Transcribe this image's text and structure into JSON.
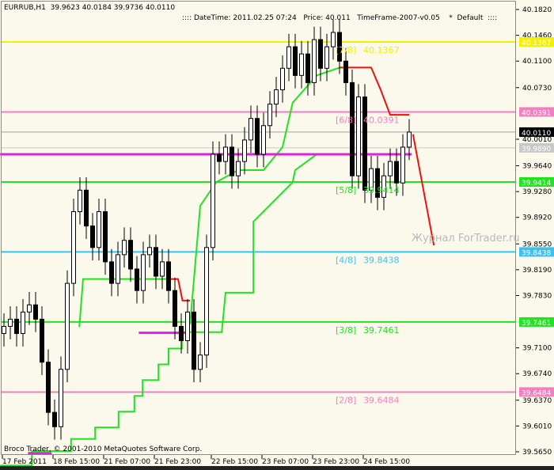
{
  "header": {
    "symbol_info": "EURRUB,H1  39.9623 40.0184 39.9736 40.0110",
    "indicator_info": ":::: DateTime: 2011.02.25 07:24   Price: 40.011   TimeFrame-2007-v0.05    *  Default  ::::"
  },
  "footer": {
    "copyright": "Broco Trader, © 2001-2010 MetaQuotes Software Corp."
  },
  "watermark": "Журнал ForTrader.ru",
  "colors": {
    "background": "#fbf9ec",
    "yellow": "#f5f000",
    "pink": "#f27fc0",
    "green": "#22e222",
    "cyan": "#3cc2f0",
    "red": "#f01010",
    "magenta": "#e020e0"
  },
  "chart_data": {
    "type": "candlestick",
    "title": "EURRUB,H1",
    "ylim": [
      39.565,
      40.182
    ],
    "y_ticks": [
      "40.1820",
      "40.1460",
      "40.1100",
      "40.0730",
      "40.0010",
      "39.9640",
      "39.9280",
      "39.8920",
      "39.8550",
      "39.8190",
      "39.7830",
      "39.7100",
      "39.6740",
      "39.6370",
      "39.6010",
      "39.5650"
    ],
    "x_ticks": [
      {
        "bar": 0,
        "label": "17 Feb 2011"
      },
      {
        "bar": 8,
        "label": "18 Feb 15:00"
      },
      {
        "bar": 16,
        "label": "21 Feb 07:00"
      },
      {
        "bar": 24,
        "label": "21 Feb 23:00"
      },
      {
        "bar": 33,
        "label": "22 Feb 15:00"
      },
      {
        "bar": 41,
        "label": "23 Feb 07:00"
      },
      {
        "bar": 49,
        "label": "23 Feb 23:00"
      },
      {
        "bar": 57,
        "label": "24 Feb 15:00"
      }
    ],
    "closes": [
      39.74,
      39.75,
      39.73,
      39.76,
      39.77,
      39.75,
      39.69,
      39.62,
      39.6,
      39.68,
      39.8,
      39.9,
      39.93,
      39.88,
      39.85,
      39.9,
      39.83,
      39.8,
      39.84,
      39.86,
      39.82,
      39.79,
      39.84,
      39.85,
      39.81,
      39.83,
      39.79,
      39.74,
      39.72,
      39.76,
      39.68,
      39.7,
      39.85,
      39.98,
      39.97,
      39.99,
      39.95,
      39.97,
      40.0,
      40.03,
      39.98,
      40.02,
      40.05,
      40.07,
      40.1,
      40.13,
      40.09,
      40.12,
      40.08,
      40.14,
      40.1,
      40.13,
      40.15,
      40.11,
      40.08,
      39.95,
      40.06,
      39.93,
      39.96,
      39.92,
      39.95,
      39.97,
      39.94,
      39.99,
      40.011
    ],
    "levels": [
      {
        "name": "[7/8]",
        "value": "40.1367",
        "price": 40.1367,
        "color": "#f5f000"
      },
      {
        "name": "[6/8]",
        "value": "40.0391",
        "price": 40.0391,
        "color": "#f27fc0"
      },
      {
        "name": "[5/8]",
        "value": "39.9414",
        "price": 39.9414,
        "color": "#22e222"
      },
      {
        "name": "[4/8]",
        "value": "39.8438",
        "price": 39.8438,
        "color": "#3cc2f0"
      },
      {
        "name": "[3/8]",
        "value": "39.7461",
        "price": 39.7461,
        "color": "#22e222"
      },
      {
        "name": "[2/8]",
        "value": "39.6484",
        "price": 39.6484,
        "color": "#f27fc0"
      }
    ],
    "price_tags": [
      {
        "value": "40.1367",
        "price": 40.1367,
        "bg": "#f5f000",
        "fg": "#ffffff"
      },
      {
        "value": "40.0391",
        "price": 40.0391,
        "bg": "#f27fc0",
        "fg": "#ffffff"
      },
      {
        "value": "40.0110",
        "price": 40.011,
        "bg": "#000000",
        "fg": "#ffffff"
      },
      {
        "value": "39.9890",
        "price": 39.989,
        "bg": "#c8c8c8",
        "fg": "#ffffff"
      },
      {
        "value": "39.9414",
        "price": 39.9414,
        "bg": "#22e222",
        "fg": "#ffffff"
      },
      {
        "value": "39.8438",
        "price": 39.8438,
        "bg": "#3cc2f0",
        "fg": "#ffffff"
      },
      {
        "value": "39.7461",
        "price": 39.7461,
        "bg": "#22e222",
        "fg": "#ffffff"
      },
      {
        "value": "39.6484",
        "price": 39.6484,
        "bg": "#f27fc0",
        "fg": "#ffffff"
      }
    ],
    "current_price": 40.011,
    "grey_level": 39.989,
    "series": [
      {
        "name": "support-lower",
        "color": "#22e222",
        "points": [
          [
            -0.6,
            39.546
          ],
          [
            4.4,
            39.546
          ],
          [
            4.4,
            39.566
          ],
          [
            10.6,
            39.566
          ],
          [
            10.6,
            39.583
          ],
          [
            14.4,
            39.583
          ],
          [
            14.4,
            39.599
          ],
          [
            18.1,
            39.599
          ],
          [
            18.1,
            39.621
          ],
          [
            20.6,
            39.621
          ],
          [
            20.6,
            39.643
          ],
          [
            21.9,
            39.643
          ],
          [
            21.9,
            39.665
          ],
          [
            24.4,
            39.665
          ],
          [
            24.4,
            39.687
          ],
          [
            26,
            39.687
          ],
          [
            26,
            39.709
          ],
          [
            28.1,
            39.709
          ],
          [
            28.1,
            39.732
          ],
          [
            34.4,
            39.732
          ],
          [
            35,
            39.787
          ],
          [
            39.4,
            39.787
          ],
          [
            39.4,
            39.886
          ],
          [
            45.6,
            39.941
          ],
          [
            46,
            39.958
          ],
          [
            49.4,
            39.98
          ],
          [
            64.4,
            39.98
          ]
        ]
      },
      {
        "name": "support-upper-1",
        "color": "#22e222",
        "points": [
          [
            11.9,
            39.739
          ],
          [
            12.5,
            39.806
          ],
          [
            25.6,
            39.806
          ]
        ]
      },
      {
        "name": "resistance-1",
        "color": "#f01010",
        "points": [
          [
            25.6,
            39.806
          ],
          [
            27.5,
            39.806
          ],
          [
            28.2,
            39.776
          ],
          [
            29.4,
            39.776
          ]
        ]
      },
      {
        "name": "support-upper-2",
        "color": "#22e222",
        "points": [
          [
            29.4,
            39.743
          ],
          [
            31,
            39.908
          ],
          [
            33.5,
            39.941
          ],
          [
            37,
            39.958
          ],
          [
            41,
            39.958
          ],
          [
            44,
            39.99
          ],
          [
            45.6,
            40.052
          ],
          [
            49.4,
            40.09
          ],
          [
            53,
            40.101
          ]
        ]
      },
      {
        "name": "resistance-2",
        "color": "#f01010",
        "points": [
          [
            53,
            40.101
          ],
          [
            58,
            40.101
          ],
          [
            59.5,
            40.07
          ],
          [
            61,
            40.035
          ],
          [
            64,
            40.035
          ]
        ]
      },
      {
        "name": "forecast",
        "color": "#f01010",
        "points": [
          [
            64.6,
            40.008
          ],
          [
            67.9,
            39.853
          ]
        ]
      },
      {
        "name": "magenta-main",
        "color": "#e020e0",
        "points": [
          [
            -0.6,
            39.98
          ],
          [
            64.4,
            39.98
          ]
        ]
      },
      {
        "name": "magenta-seg-1",
        "color": "#e020e0",
        "points": [
          [
            3.8,
            39.563
          ],
          [
            7.5,
            39.563
          ]
        ]
      },
      {
        "name": "magenta-seg-2",
        "color": "#e020e0",
        "points": [
          [
            21.3,
            39.731
          ],
          [
            28.8,
            39.731
          ]
        ]
      }
    ]
  }
}
